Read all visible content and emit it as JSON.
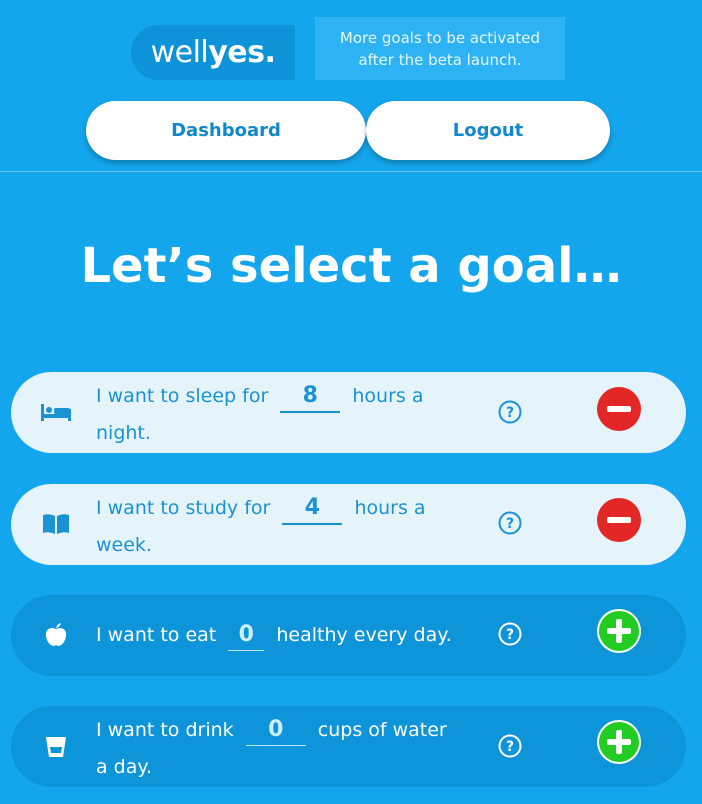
{
  "header": {
    "logo_light": "well",
    "logo_bold": "yes.",
    "notice": "More goals to be activated after the beta launch."
  },
  "nav": {
    "dashboard_label": "Dashboard",
    "logout_label": "Logout"
  },
  "main": {
    "title": "Let’s select a goal…"
  },
  "goals": [
    {
      "icon": "bed-icon",
      "prefix": "I want to sleep for",
      "value": "8",
      "suffix": "hours a night.",
      "state": "active",
      "action": "remove"
    },
    {
      "icon": "book-icon",
      "prefix": "I want to study for",
      "value": "4",
      "suffix": "hours a week.",
      "state": "active",
      "action": "remove"
    },
    {
      "icon": "apple-icon",
      "prefix": "I want to eat",
      "value": "0",
      "suffix": "healthy every day.",
      "state": "inactive",
      "action": "add"
    },
    {
      "icon": "glass-icon",
      "prefix": "I want to drink",
      "value": "0",
      "suffix": "cups of water a day.",
      "state": "inactive",
      "action": "add"
    }
  ],
  "colors": {
    "background": "#14a6ec",
    "active_card": "#e5f4fb",
    "inactive_card": "#0e94d8",
    "remove": "#e32626",
    "add": "#22cc22"
  }
}
